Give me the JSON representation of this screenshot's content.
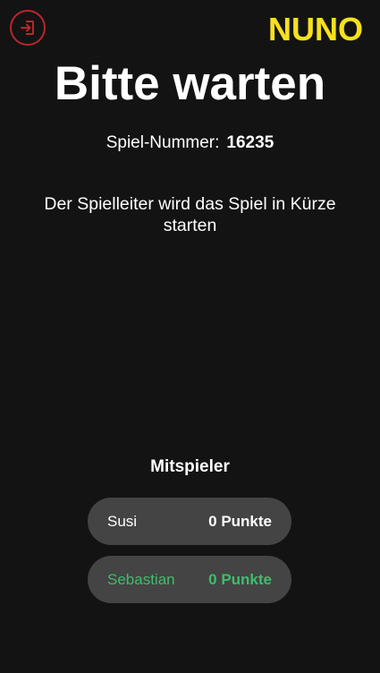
{
  "logo": {
    "text": "NUNO",
    "fill": "#f7e11b",
    "stroke": "#1e1e1e"
  },
  "header": {
    "exit_icon": "exit-icon"
  },
  "main": {
    "title": "Bitte warten",
    "game_number_label": "Spiel-Nummer:",
    "game_number": "16235",
    "info_text": "Der Spielleiter wird das Spiel in Kürze starten"
  },
  "players": {
    "heading": "Mitspieler",
    "list": [
      {
        "name": "Susi",
        "score": "0 Punkte",
        "current": false
      },
      {
        "name": "Sebastian",
        "score": "0 Punkte",
        "current": true
      }
    ]
  },
  "colors": {
    "background": "#131313",
    "exit_accent": "#b9262b",
    "current_player": "#3dbe6c",
    "pill": "#444444"
  }
}
